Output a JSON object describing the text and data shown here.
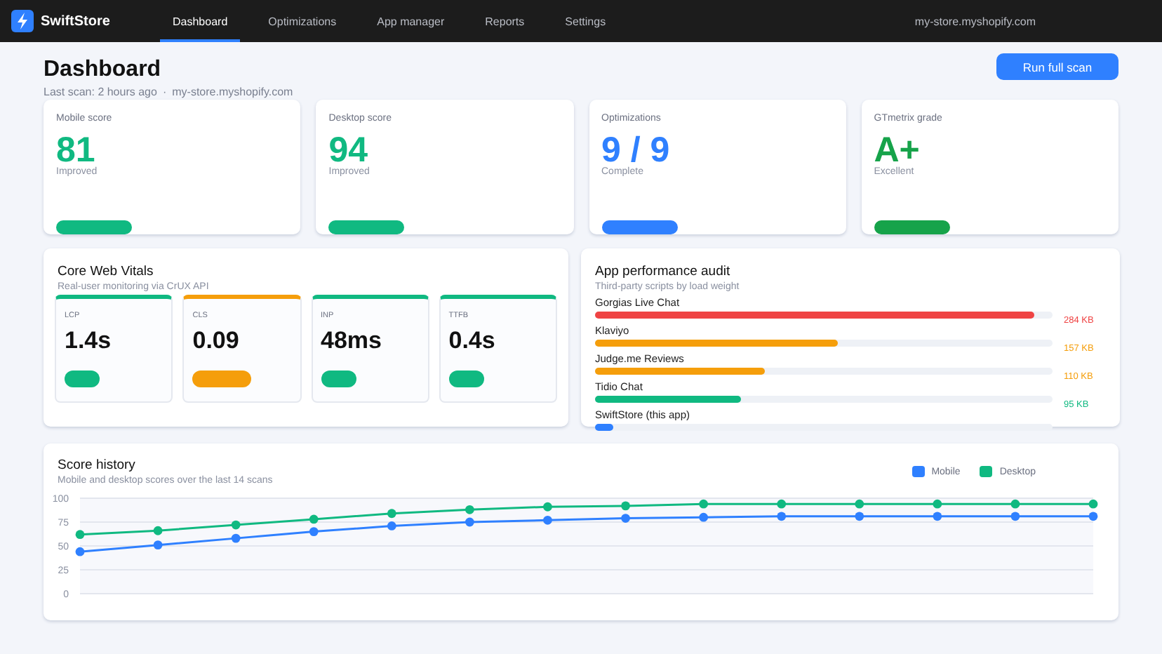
{
  "nav": {
    "brand": "SwiftStore",
    "tabs": [
      {
        "label": "Dashboard",
        "selected": true
      },
      {
        "label": "Optimizations",
        "selected": false
      },
      {
        "label": "App manager",
        "selected": false
      },
      {
        "label": "Reports",
        "selected": false
      },
      {
        "label": "Settings",
        "selected": false
      }
    ],
    "store": "my-store.myshopify.com"
  },
  "header": {
    "title": "Dashboard",
    "last_scan": "Last scan: 2 hours ago",
    "separator": "·",
    "store": "my-store.myshopify.com",
    "button": "Run full scan"
  },
  "stats": [
    {
      "label": "Mobile score",
      "value": "81",
      "note": "Improved",
      "color": "#10b981"
    },
    {
      "label": "Desktop score",
      "value": "94",
      "note": "Improved",
      "color": "#10b981"
    },
    {
      "label": "Optimizations",
      "value": "9 / 9",
      "note": "Complete",
      "color": "#2f80ff"
    },
    {
      "label": "GTmetrix grade",
      "value": "A+",
      "note": "Excellent",
      "color": "#16a34a"
    }
  ],
  "vitals": {
    "title": "Core Web Vitals",
    "subtitle": "Real-user monitoring via CrUX API",
    "items": [
      {
        "label": "LCP",
        "value": "1.4s",
        "color": "#10b981"
      },
      {
        "label": "CLS",
        "value": "0.09",
        "color": "#f59e0b"
      },
      {
        "label": "INP",
        "value": "48ms",
        "color": "#10b981"
      },
      {
        "label": "TTFB",
        "value": "0.4s",
        "color": "#10b981"
      }
    ]
  },
  "audit": {
    "title": "App performance audit",
    "subtitle": "Third-party scripts by load weight",
    "apps": [
      {
        "name": "Gorgias Live Chat",
        "size": "284 KB",
        "level": 0.96,
        "color": "#ef4444"
      },
      {
        "name": "Klaviyo",
        "size": "157 KB",
        "level": 0.53,
        "color": "#f59e0b"
      },
      {
        "name": "Judge.me Reviews",
        "size": "110 KB",
        "level": 0.37,
        "color": "#f59e0b"
      },
      {
        "name": "Tidio Chat",
        "size": "95 KB",
        "level": 0.32,
        "color": "#10b981"
      },
      {
        "name": "SwiftStore (this app)",
        "level": 0.04,
        "color": "#2f80ff"
      }
    ]
  },
  "history": {
    "title": "Score history",
    "subtitle": "Mobile and desktop scores over the last 14 scans",
    "chart_data": {
      "type": "line",
      "grid": true,
      "ylim": [
        0,
        100
      ],
      "yticks": [
        0,
        25,
        50,
        75,
        100
      ],
      "series": [
        {
          "name": "Mobile",
          "color": "#2f80ff",
          "marker": "circle",
          "values": [
            44,
            51,
            58,
            65,
            71,
            75,
            77,
            79,
            80,
            81,
            81,
            81,
            81,
            81
          ]
        },
        {
          "name": "Desktop",
          "color": "#10b981",
          "marker": "circle",
          "values": [
            62,
            66,
            72,
            78,
            84,
            88,
            91,
            92,
            94,
            94,
            94,
            94,
            94,
            94
          ]
        }
      ]
    }
  }
}
